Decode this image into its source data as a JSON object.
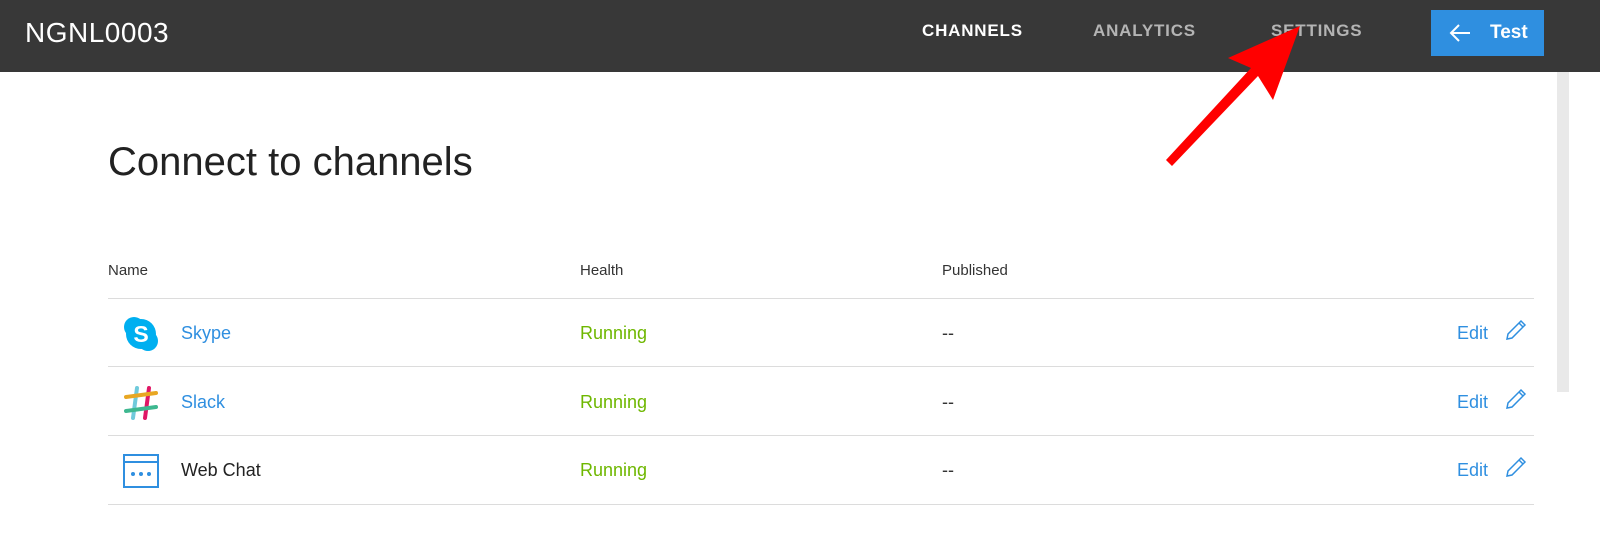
{
  "app": {
    "title": "NGNL0003"
  },
  "nav": {
    "tabs": [
      {
        "label": "CHANNELS",
        "active": true
      },
      {
        "label": "ANALYTICS",
        "active": false
      },
      {
        "label": "SETTINGS",
        "active": false
      }
    ],
    "test_button": {
      "label": "Test",
      "icon": "arrow-left-icon"
    }
  },
  "main": {
    "title": "Connect to channels",
    "table": {
      "columns": [
        "Name",
        "Health",
        "Published"
      ],
      "rows": [
        {
          "icon": "skype-icon",
          "name": "Skype",
          "health": "Running",
          "published": "--",
          "edit": "Edit"
        },
        {
          "icon": "slack-icon",
          "name": "Slack",
          "health": "Running",
          "published": "--",
          "edit": "Edit"
        },
        {
          "icon": "web-chat-icon",
          "name": "Web Chat",
          "health": "Running",
          "published": "--",
          "edit": "Edit"
        }
      ]
    }
  },
  "colors": {
    "topbar": "#383838",
    "accent": "#2f8fe0",
    "health_running": "#6eb700",
    "annotation_arrow": "#ff0000"
  }
}
